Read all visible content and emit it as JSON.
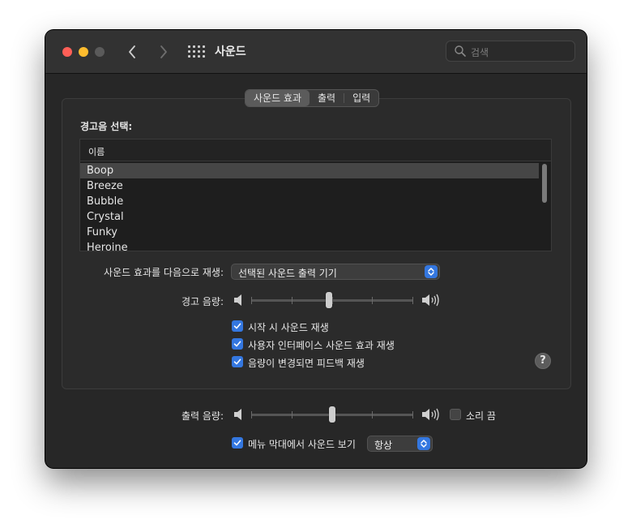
{
  "window": {
    "title": "사운드",
    "search_placeholder": "검색"
  },
  "colors": {
    "accent": "#3477e0",
    "window_bg": "#272727",
    "close": "#ff5f57",
    "minimize": "#febc2e"
  },
  "icons": [
    "back-chevron-icon",
    "forward-chevron-icon",
    "grid-icon",
    "search-icon",
    "speaker-low-icon",
    "speaker-high-icon",
    "help-icon",
    "checkmark-icon",
    "popup-arrows-icon"
  ],
  "tabs": [
    {
      "label": "사운드 효과",
      "active": true
    },
    {
      "label": "출력",
      "active": false
    },
    {
      "label": "입력",
      "active": false
    }
  ],
  "alert_section": {
    "title": "경고음 선택:",
    "column_header": "이름",
    "items": [
      "Boop",
      "Breeze",
      "Bubble",
      "Crystal",
      "Funky",
      "Heroine"
    ],
    "selected": "Boop"
  },
  "play_through": {
    "label": "사운드 효과를 다음으로 재생:",
    "value": "선택된 사운드 출력 기기"
  },
  "alert_volume": {
    "label": "경고 음량:",
    "level": 0.48
  },
  "checkboxes": [
    {
      "label": "시작 시 사운드 재생",
      "checked": true
    },
    {
      "label": "사용자 인터페이스 사운드 효과 재생",
      "checked": true
    },
    {
      "label": "음량이 변경되면 피드백 재생",
      "checked": true
    }
  ],
  "help": {
    "label": "?"
  },
  "output_volume": {
    "label": "출력 음량:",
    "level": 0.5,
    "mute_label": "소리 끔",
    "muted": false
  },
  "menu_bar": {
    "label": "메뉴 막대에서 사운드 보기",
    "checked": true,
    "value": "항상"
  }
}
